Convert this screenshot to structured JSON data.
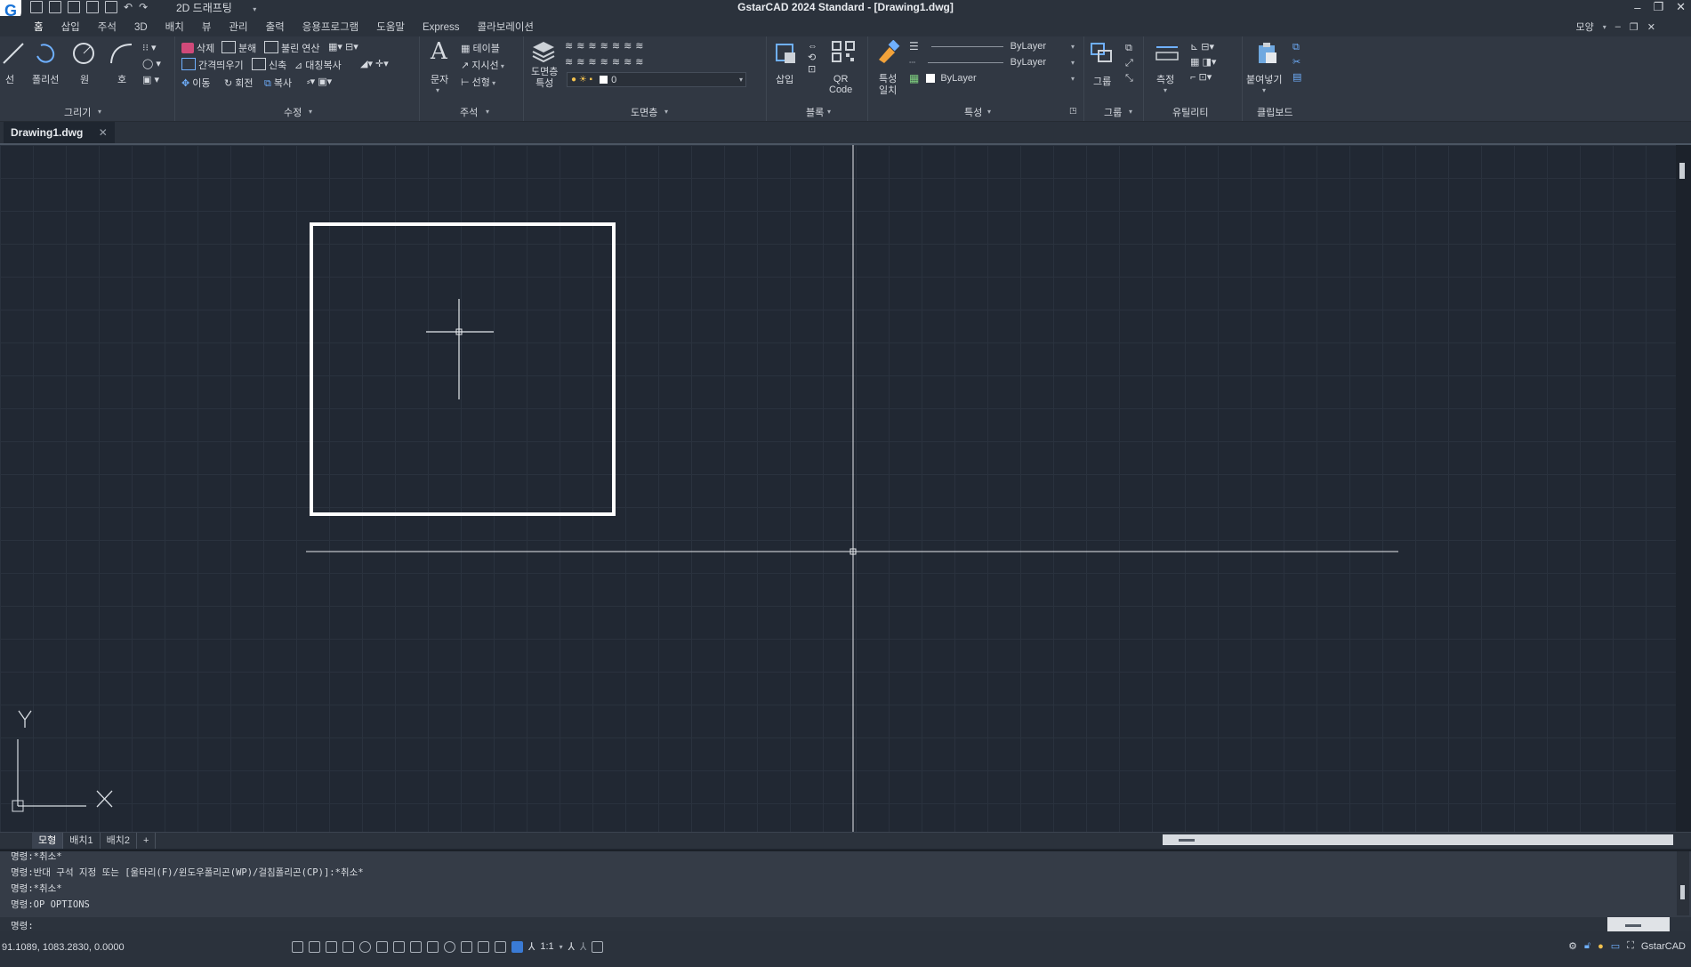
{
  "app": {
    "title": "GstarCAD 2024 Standard - [Drawing1.dwg]",
    "logo": "G",
    "workspace": "2D 드래프팅"
  },
  "menu": {
    "tabs": [
      "홈",
      "삽입",
      "주석",
      "3D",
      "배치",
      "뷰",
      "관리",
      "출력",
      "응용프로그램",
      "도움말",
      "Express",
      "콜라보레이션"
    ],
    "right_label": "모양"
  },
  "ribbon": {
    "draw": {
      "title": "그리기",
      "line": "선",
      "polyline": "폴리선",
      "circle": "원",
      "arc": "호"
    },
    "modify": {
      "title": "수정",
      "erase": "삭제",
      "explode": "분해",
      "boolean": "불린 연산",
      "offset": "간격띄우기",
      "stretch": "신축",
      "mirror": "대칭복사",
      "move": "이동",
      "rotate": "회전",
      "copy": "복사"
    },
    "annotation": {
      "title": "주석",
      "text": "문자",
      "table": "테이블",
      "leader": "지시선",
      "dim": "선형"
    },
    "layers": {
      "title": "도면층",
      "properties": "도면층\n특성",
      "current": "0"
    },
    "block": {
      "title": "블록",
      "insert": "삽입",
      "qr": "QR\nCode"
    },
    "properties": {
      "title": "특성",
      "match": "특성\n일치",
      "color": "ByLayer",
      "linetype": "ByLayer",
      "lineweight": "ByLayer"
    },
    "groups": {
      "title": "그룹",
      "group": "그룹"
    },
    "utilities": {
      "title": "유틸리티",
      "measure": "측정"
    },
    "clipboard": {
      "title": "클립보드",
      "paste": "붙여넣기"
    }
  },
  "document": {
    "tab": "Drawing1.dwg"
  },
  "layout_tabs": [
    "모형",
    "배치1",
    "배치2",
    "+"
  ],
  "command": {
    "lines": [
      "명령:*취소*",
      "명령:반대 구석 지정 또는 [울타리(F)/윈도우폴리곤(WP)/걸침폴리곤(CP)]:*취소*",
      "명령:*취소*",
      "명령:OP OPTIONS"
    ],
    "prompt": "명령:"
  },
  "status": {
    "coords": "91.1089, 1083.2830, 0.0000",
    "scale": "1:1",
    "brand": "GstarCAD"
  },
  "colors": {
    "canvas": "#212833",
    "ribbon": "#313843",
    "accent": "#1a73d6"
  }
}
